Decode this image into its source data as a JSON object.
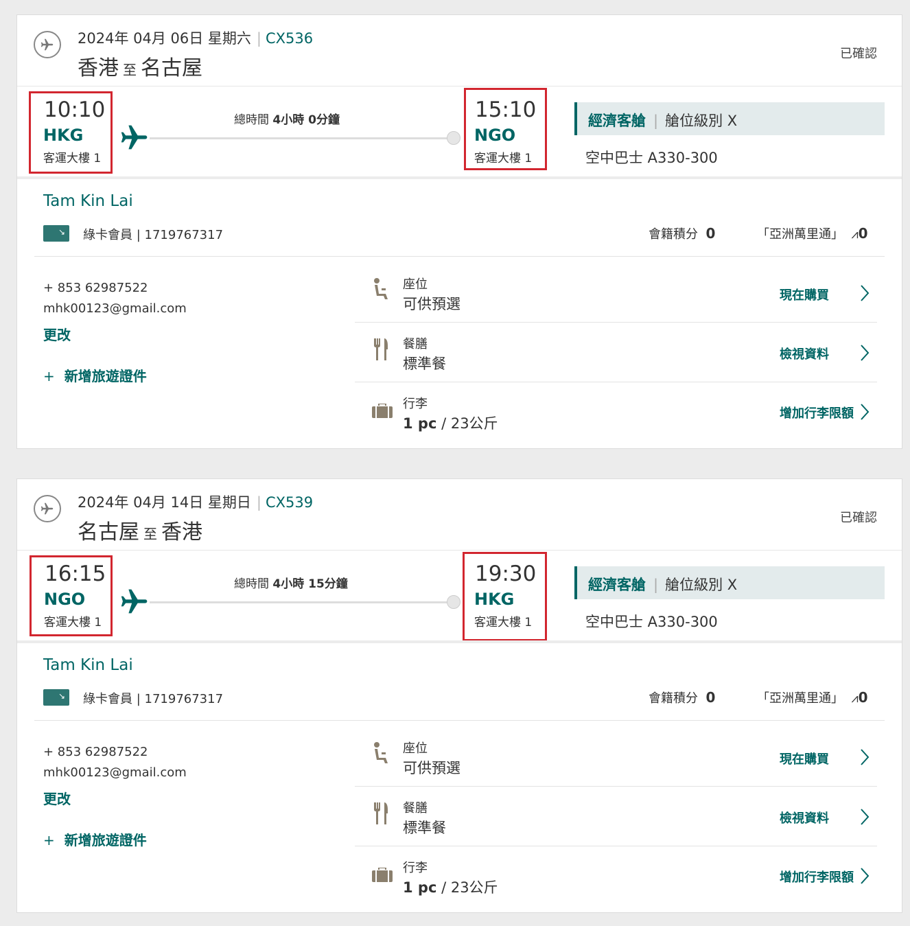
{
  "flights": [
    {
      "date": "2024年 04月 06日 星期六",
      "flight_no": "CX536",
      "route_from": "香港",
      "route_to_word": "至",
      "route_to": "名古屋",
      "status": "已確認",
      "dep_time": "10:10",
      "dep_code": "HKG",
      "dep_terminal": "客運大樓 1",
      "arr_time": "15:10",
      "arr_code": "NGO",
      "arr_terminal": "客運大樓 1",
      "duration_label": "總時間",
      "duration_value": "4小時 0分鐘",
      "cabin": "經濟客艙",
      "booking_class": "艙位級別 X",
      "aircraft": "空中巴士 A330-300",
      "passenger": "Tam Kin Lai",
      "member": "綠卡會員 | 1719767317",
      "status_points_label": "會籍積分",
      "status_points": "0",
      "asia_miles_label": "「亞洲萬里通」",
      "asia_miles": "0",
      "phone": "+ 853 62987522",
      "email": "mhk00123@gmail.com",
      "change_link": "更改",
      "add_doc_plus": "+",
      "add_doc": "新增旅遊證件",
      "seat_label": "座位",
      "seat_value": "可供預選",
      "seat_action": "現在購買",
      "meal_label": "餐膳",
      "meal_value": "標準餐",
      "meal_action": "檢視資料",
      "bag_label": "行李",
      "bag_value_bold": "1 pc",
      "bag_value_rest": " / 23公斤",
      "bag_action": "增加行李限額"
    },
    {
      "date": "2024年 04月 14日 星期日",
      "flight_no": "CX539",
      "route_from": "名古屋",
      "route_to_word": "至",
      "route_to": "香港",
      "status": "已確認",
      "dep_time": "16:15",
      "dep_code": "NGO",
      "dep_terminal": "客運大樓 1",
      "arr_time": "19:30",
      "arr_code": "HKG",
      "arr_terminal": "客運大樓 1",
      "duration_label": "總時間",
      "duration_value": "4小時 15分鐘",
      "cabin": "經濟客艙",
      "booking_class": "艙位級別 X",
      "aircraft": "空中巴士 A330-300",
      "passenger": "Tam Kin Lai",
      "member": "綠卡會員 | 1719767317",
      "status_points_label": "會籍積分",
      "status_points": "0",
      "asia_miles_label": "「亞洲萬里通」",
      "asia_miles": "0",
      "phone": "+ 853 62987522",
      "email": "mhk00123@gmail.com",
      "change_link": "更改",
      "add_doc_plus": "+",
      "add_doc": "新增旅遊證件",
      "seat_label": "座位",
      "seat_value": "可供預選",
      "seat_action": "現在購買",
      "meal_label": "餐膳",
      "meal_value": "標準餐",
      "meal_action": "檢視資料",
      "bag_label": "行李",
      "bag_value_bold": "1 pc",
      "bag_value_rest": " / 23公斤",
      "bag_action": "增加行李限額"
    }
  ],
  "colors": {
    "brand": "#006564",
    "highlight_border": "#d2262f",
    "cabin_bg": "#e3ebec"
  }
}
